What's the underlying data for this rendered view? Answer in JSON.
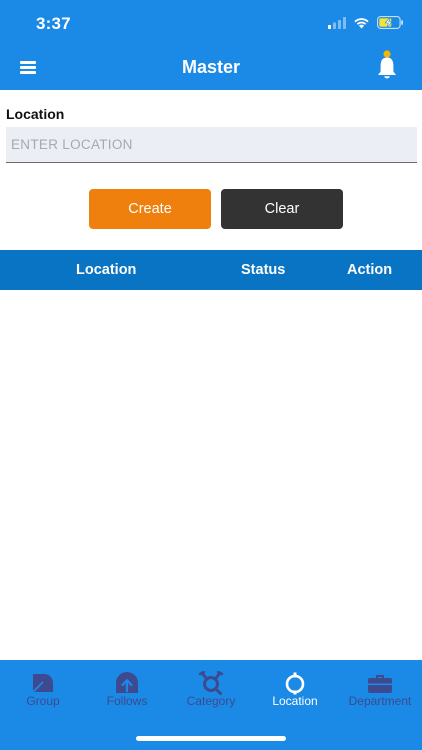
{
  "status_bar": {
    "time": "3:37"
  },
  "navbar": {
    "title": "Master",
    "menu_icon": "hamburger-menu-icon",
    "bell_icon": "bell-icon"
  },
  "form": {
    "label": "Location",
    "placeholder": "ENTER LOCATION",
    "value": "",
    "create_label": "Create",
    "clear_label": "Clear"
  },
  "table": {
    "columns": [
      "Location",
      "Status",
      "Action"
    ],
    "rows": []
  },
  "tabs": [
    {
      "label": "Group",
      "icon": "group-icon",
      "active": false
    },
    {
      "label": "Follows",
      "icon": "follows-icon",
      "active": false
    },
    {
      "label": "Category",
      "icon": "category-icon",
      "active": false
    },
    {
      "label": "Location",
      "icon": "location-icon",
      "active": true
    },
    {
      "label": "Department",
      "icon": "department-icon",
      "active": false
    }
  ],
  "colors": {
    "primary": "#1a8ae6",
    "table_header": "#0a74c4",
    "create_button": "#f0800e",
    "clear_button": "#333333",
    "inactive_tab": "#3e4a8f",
    "bell_dot": "#f5b400"
  }
}
